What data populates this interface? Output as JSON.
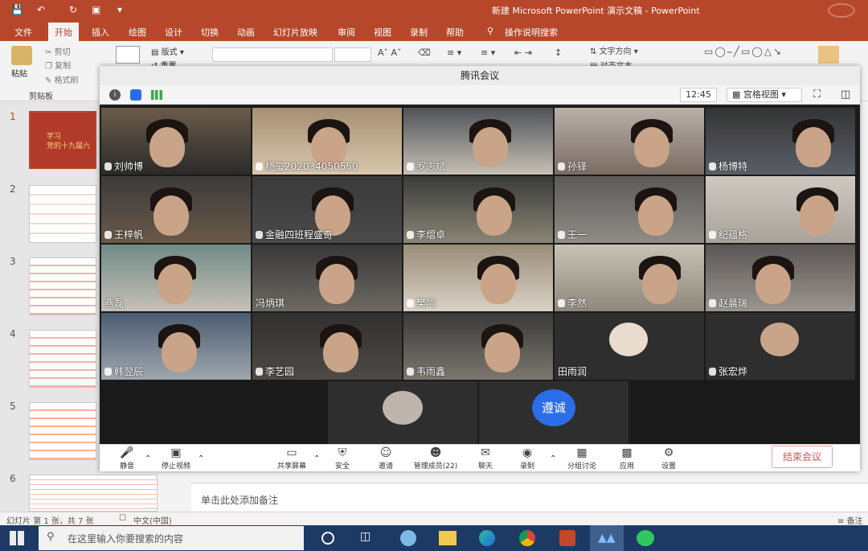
{
  "ppt": {
    "title": "新建 Microsoft PowerPoint 演示文稿 - PowerPoint",
    "tabs": [
      "文件",
      "开始",
      "插入",
      "绘图",
      "设计",
      "切换",
      "动画",
      "幻灯片放映",
      "审阅",
      "视图",
      "录制",
      "帮助"
    ],
    "active_tab": "开始",
    "tell_me": "操作说明搜索",
    "clipboard": {
      "paste": "粘贴",
      "cut": "剪切",
      "copy": "复制",
      "format_painter": "格式刷",
      "group": "剪贴板"
    },
    "slides_group": {
      "layout": "版式",
      "reset": "重置"
    },
    "text_direction": "文字方向",
    "align_text": "对齐文本",
    "slide_numbers": [
      "1",
      "2",
      "3",
      "4",
      "5",
      "6"
    ],
    "slide1_text": [
      "学习",
      "党的十九届六"
    ],
    "notes_placeholder": "单击此处添加备注",
    "status": {
      "slide_info": "幻灯片 第 1 张，共 7 张",
      "language": "中文(中国)",
      "notes": "备注"
    }
  },
  "taskbar": {
    "search_placeholder": "在这里输入你要搜索的内容"
  },
  "meeting": {
    "window_title": "腾讯会议",
    "time": "12:45",
    "view_mode": "宫格视图",
    "participants": [
      {
        "name": "刘帅博"
      },
      {
        "name": "杨玺202034050550"
      },
      {
        "name": "罗志斌"
      },
      {
        "name": "孙铎"
      },
      {
        "name": "杨博特"
      },
      {
        "name": "王梓帆"
      },
      {
        "name": "金融四班程盛奇"
      },
      {
        "name": "李熠卓"
      },
      {
        "name": "王一"
      },
      {
        "name": "纪蕴格"
      },
      {
        "name": "燕磊"
      },
      {
        "name": "冯炳琪"
      },
      {
        "name": "樊响"
      },
      {
        "name": "李然"
      },
      {
        "name": "赵晨瑞"
      },
      {
        "name": "韩翌辰"
      },
      {
        "name": "李艺园"
      },
      {
        "name": "韦雨鑫"
      },
      {
        "name": "田雨润"
      },
      {
        "name": "张宏烨"
      }
    ],
    "extra_avatar_text": "遵诚",
    "toolbar": {
      "mute": "静音",
      "stop_video": "停止视频",
      "share_screen": "共享屏幕",
      "security": "安全",
      "invite": "邀请",
      "manage_members": "管理成员(22)",
      "chat": "聊天",
      "record": "录制",
      "breakout": "分组讨论",
      "apps": "应用",
      "settings": "设置",
      "end_meeting": "结束会议"
    },
    "colors": {
      "end_meeting": "#d9534f",
      "avatar_blue": "#2b6de8"
    }
  }
}
